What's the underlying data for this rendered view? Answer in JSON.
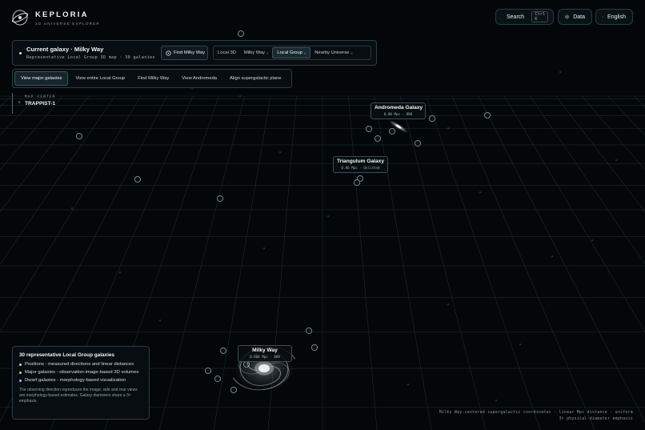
{
  "app": {
    "name": "KEPLORIA",
    "tagline": "3D UNIVERSE EXPLORER"
  },
  "header": {
    "search_label": "Search",
    "search_shortcut": "Ctrl K",
    "data_label": "Data",
    "language_label": "English"
  },
  "galaxy_bar": {
    "title": "Current galaxy · Milky Way",
    "subtitle": "Representative Local Group 3D map · 30 galaxies",
    "find_label": "Find Milky Way",
    "scopes": [
      {
        "label": "Local 3D",
        "closable": false,
        "active": false
      },
      {
        "label": "Milky Way",
        "closable": true,
        "active": false
      },
      {
        "label": "Local Group",
        "closable": true,
        "active": true
      },
      {
        "label": "Nearby Universe",
        "closable": true,
        "active": false
      }
    ],
    "close_glyph": "x"
  },
  "view_toolbar": {
    "buttons": [
      {
        "label": "View major galaxies",
        "active": true
      },
      {
        "label": "View entire Local Group",
        "active": false
      },
      {
        "label": "Find Milky Way",
        "active": false
      },
      {
        "label": "View Andromeda",
        "active": false
      },
      {
        "label": "Align supergalactic plane",
        "active": false
      }
    ]
  },
  "map_center": {
    "label": "MAP CENTER",
    "value": "TRAPPIST-1"
  },
  "galaxies": {
    "andromeda": {
      "name": "Andromeda Galaxy",
      "meta": "0.80 Mpc · 880"
    },
    "triangulum": {
      "name": "Triangulum Galaxy",
      "meta": "0.86 Mpc · Unlisted"
    },
    "milky_way": {
      "name": "Milky Way",
      "meta": "0.000 Mpc · 880"
    }
  },
  "legend": {
    "title": "30 representative Local Group galaxies",
    "items": [
      {
        "text": "Positions - measured directions and linear distances",
        "color": "#9fd8e6"
      },
      {
        "text": "Major galaxies - observation-image-based 3D volumes",
        "color": "#e8b98a"
      },
      {
        "text": "Dwarf galaxies - morphology-based visualization",
        "color": "#a9b6ee"
      }
    ],
    "note": "The observing direction reproduces the image; side and rear views are morphology-based estimates. Galaxy diameters share a 3× emphasis."
  },
  "footer": {
    "line1": "Milky Way-centered supergalactic coordinates · linear Mpc distance · uniform",
    "line2": "3× physical-diameter emphasis"
  },
  "icons": {
    "logo": "orbit-logo-icon",
    "search": "search-icon",
    "data": "database-icon",
    "language": "globe-icon",
    "find": "crosshair-icon",
    "map_center": "plus-icon"
  }
}
